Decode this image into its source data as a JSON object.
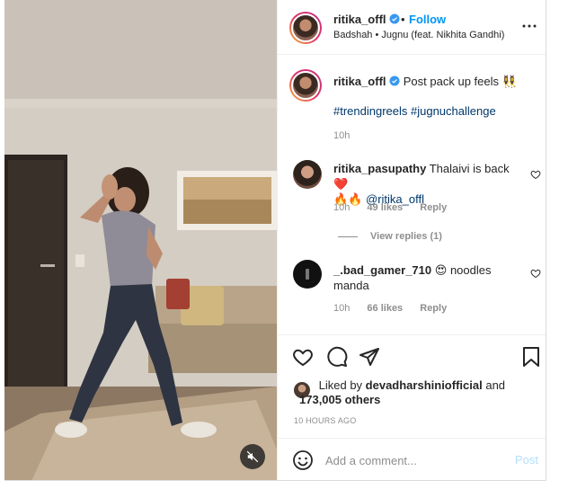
{
  "post": {
    "username": "ritika_offl",
    "follow_label": "Follow",
    "separator": "•",
    "audio": "Badshah • Jugnu (feat. Nikhita Gandhi)"
  },
  "caption": {
    "username": "ritika_offl",
    "text": "Post pack up feels",
    "emoji": "👯‍♀️",
    "hashtags": "#trendingreels #jugnuchallenge",
    "time": "10h"
  },
  "comments": [
    {
      "username": "ritika_pasupathy",
      "text": "Thalaivi is back",
      "emoji_after": "❤️",
      "line2_emoji": "🔥🔥",
      "mention": "@ritika_offl",
      "time": "10h",
      "likes": "49 likes",
      "reply_label": "Reply",
      "view_replies": "View replies (1)"
    },
    {
      "username": "_.bad_gamer_710",
      "emoji": "😍",
      "text_line1": "noodles",
      "text_line2": "manda",
      "time": "10h",
      "likes": "66 likes",
      "reply_label": "Reply"
    }
  ],
  "likes": {
    "prefix": "Liked by",
    "user": "devadharshiniofficial",
    "and": "and",
    "others": "173,005 others"
  },
  "timestamp": "10 HOURS AGO",
  "composer": {
    "placeholder": "Add a comment...",
    "post_label": "Post"
  },
  "icons": {
    "header_more": "more-horizontal-icon",
    "like": "heart-icon",
    "comment": "comment-bubble-icon",
    "share": "paper-plane-icon",
    "save": "bookmark-icon",
    "emoji": "smiley-face-icon",
    "mute": "speaker-muted-icon",
    "verified": "verified-badge-icon"
  },
  "colors": {
    "link_blue": "#0095f6",
    "hashtag": "#00376b",
    "verified": "#3897f0",
    "muted_text": "#8e8e8e",
    "post_disabled": "#b2dffc"
  }
}
